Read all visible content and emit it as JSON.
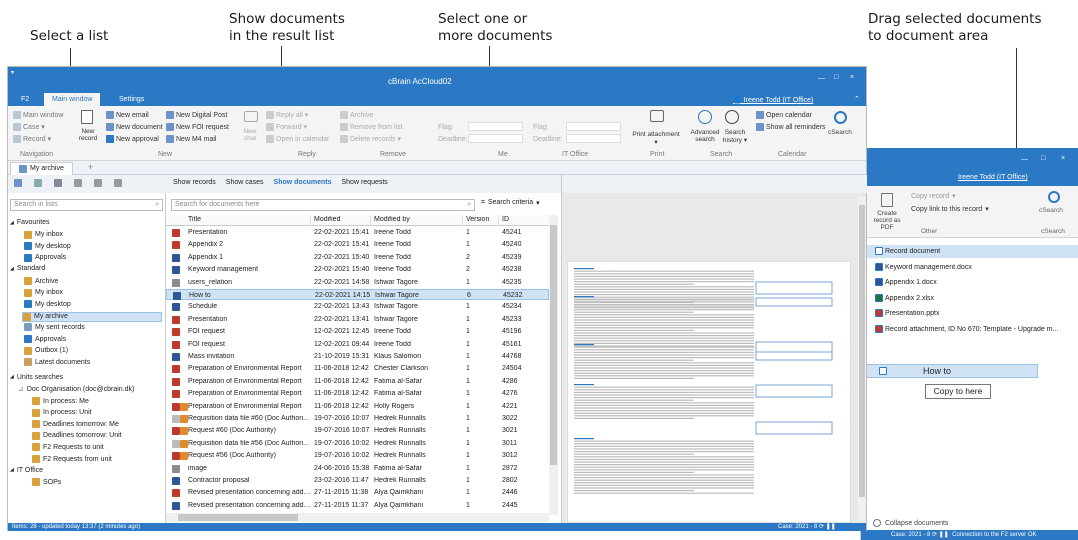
{
  "callouts": {
    "select_list": "Select a list",
    "show_docs": "Show documents\nin the result list",
    "select_docs": "Select one or\nmore documents",
    "drag_docs": "Drag selected documents\nto document area"
  },
  "window": {
    "title": "cBrain AcCloud02",
    "user": "Ireene Todd (IT Office)",
    "tabs": [
      "F2",
      "Main window",
      "Settings"
    ]
  },
  "ribbon": {
    "nav": [
      "Main window",
      "Case",
      "Record"
    ],
    "nav_group": "Navigation",
    "new_big": "New record",
    "new_items": [
      "New email",
      "New document",
      "New approval",
      "New Digital Post",
      "New FOI request",
      "New M4 mail"
    ],
    "new_group": "New",
    "reply_big": "New chat",
    "reply_items": [
      "Reply all",
      "Forward",
      "Open in calendar"
    ],
    "reply_group": "Reply",
    "remove_items": [
      "Archive",
      "Remove from list",
      "Delete records"
    ],
    "remove_group": "Remove",
    "me_items": [
      "Flag:",
      "Deadline:"
    ],
    "me_group": "Me",
    "itoffice_items": [
      "Flag:",
      "Deadline:"
    ],
    "itoffice_group": "IT Office",
    "print_btn": "Print attachment",
    "print_group": "Print",
    "search_btns": [
      "Advanced search",
      "Search history"
    ],
    "search_group": "Search",
    "calendar_items": [
      "Open calendar",
      "Show all reminders"
    ],
    "calendar_group": "Calendar",
    "csearch": "cSearch"
  },
  "doc_tab": "My archive",
  "sidebar": {
    "search_placeholder": "Search in lists",
    "favourites": "Favourites",
    "fav_items": [
      "My inbox",
      "My desktop",
      "Approvals"
    ],
    "standard": "Standard",
    "std_items": [
      "Archive",
      "My inbox",
      "My desktop",
      "My archive",
      "My sent records",
      "Approvals",
      "Outbox (1)",
      "Latest documents"
    ],
    "units": "Units searches",
    "org": "Doc Organisation (doc@cbrain.dk)",
    "org_items": [
      "In process: Me",
      "In process: Unit",
      "Deadlines tomorrow: Me",
      "Deadlines tomorrow: Unit",
      "F2 Requests to unit",
      "F2 Requests from unit"
    ],
    "itoffice": "IT Office",
    "it_items": [
      "SOPs"
    ]
  },
  "results": {
    "tabs": [
      "Show records",
      "Show cases",
      "Show documents",
      "Show requests"
    ],
    "search_placeholder": "Search for documents here",
    "criteria": "Search criteria",
    "columns": [
      "Title",
      "Modified",
      "Modified by",
      "Version",
      "ID"
    ],
    "rows": [
      [
        "Presentation",
        "22-02-2021 15:41",
        "Ireene Todd",
        "1",
        "45241"
      ],
      [
        "Appendix 2",
        "22-02-2021 15:41",
        "Ireene Todd",
        "1",
        "45240"
      ],
      [
        "Appendix 1",
        "22-02-2021 15:40",
        "Ireene Todd",
        "2",
        "45239"
      ],
      [
        "Keyword management",
        "22-02-2021 15:40",
        "Ireene Todd",
        "2",
        "45238"
      ],
      [
        "users_relation",
        "22-02-2021 14:58",
        "Ishwar Tagore",
        "1",
        "45235"
      ],
      [
        "How to",
        "22-02-2021 14:15",
        "Ishwar Tagore",
        "6",
        "45232"
      ],
      [
        "Schedule",
        "22-02-2021 13:43",
        "Ishwar Tagore",
        "1",
        "45234"
      ],
      [
        "Presentation",
        "22-02-2021 13:41",
        "Ishwar Tagore",
        "1",
        "45233"
      ],
      [
        "FOI request",
        "12-02-2021 12:45",
        "Ireene Todd",
        "1",
        "45196"
      ],
      [
        "FOI request",
        "12-02-2021 09:44",
        "Ireene Todd",
        "1",
        "45161"
      ],
      [
        "Mass invitation",
        "21-10-2019 15:31",
        "Klaus Salomon",
        "1",
        "44768"
      ],
      [
        "Preparation of Environmental Report",
        "11-06-2018 12:42",
        "Chester Clarkson",
        "1",
        "24504"
      ],
      [
        "Preparation of Environmental Report",
        "11-06-2018 12:42",
        "Fatima al-Safar",
        "1",
        "4286"
      ],
      [
        "Preparation of Environmental Report",
        "11-06-2018 12:42",
        "Fatima al-Safar",
        "1",
        "4276"
      ],
      [
        "Preparation of Environmental Report",
        "11-06-2018 12:42",
        "Holly Rogers",
        "1",
        "4221"
      ],
      [
        "Requisition data file #60 (Doc Authori...",
        "19-07-2016 10:07",
        "Hedrek Runnalls",
        "1",
        "3022"
      ],
      [
        "Request #60 (Doc Authority)",
        "19-07-2016 10:07",
        "Hedrek Runnalls",
        "1",
        "3021"
      ],
      [
        "Requisition data file #56 (Doc Authori...",
        "19-07-2016 10:02",
        "Hedrek Runnalls",
        "1",
        "3011"
      ],
      [
        "Request #56 (Doc Authority)",
        "19-07-2016 10:02",
        "Hedrek Runnalls",
        "1",
        "3012"
      ],
      [
        "image",
        "24-06-2016 15:38",
        "Fatima al-Safar",
        "1",
        "2872"
      ],
      [
        "Contractor proposal",
        "23-02-2016 11:47",
        "Hedrek Runnalls",
        "1",
        "2802"
      ],
      [
        "Revised presentation concerning adde...",
        "27-11-2015 11:38",
        "Alya Qaimkhani",
        "1",
        "2446"
      ],
      [
        "Revised presentation concerning adde...",
        "27-11-2015 11:37",
        "Alya Qaimkhani",
        "1",
        "2445"
      ]
    ]
  },
  "status": {
    "left": "Items: 28 - updated today 13:37 (2 minutes ago)",
    "case": "Case: 2021 - 8"
  },
  "second_window": {
    "user": "Ireene Todd (IT Office)",
    "copy_record": "Copy record",
    "copy_link": "Copy link to this record",
    "create_pdf": "Create record as PDF",
    "other": "Other",
    "csearch": "cSearch",
    "search_group": "cSearch",
    "docs": [
      "Record document",
      "Keyword management.docx",
      "Appendix 1.docx",
      "Appendix 2.xlsx",
      "Presentation.pptx",
      "Record attachment, ID No 670: Template - Upgrade m..."
    ],
    "drag_label": "How to",
    "copy_to_here": "Copy to here",
    "collapse": "Collapse documents",
    "status_case": "Case: 2021 - 8",
    "status_conn": "Connection to the F2 server OK"
  }
}
